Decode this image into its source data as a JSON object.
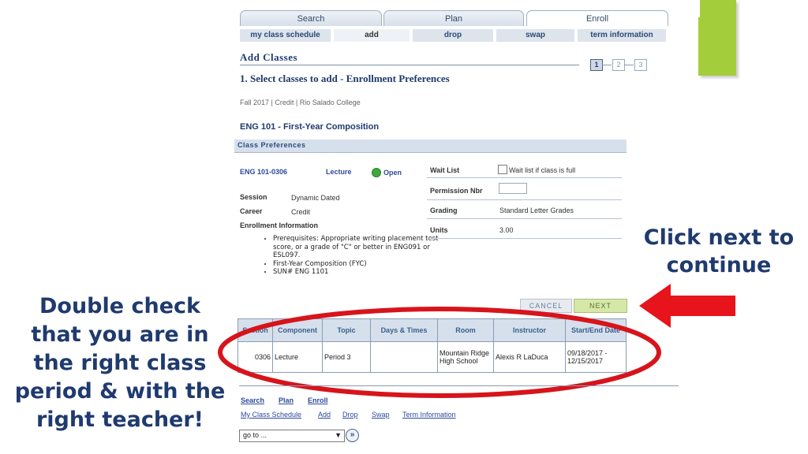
{
  "tabs": [
    {
      "label": "Search"
    },
    {
      "label": "Plan"
    },
    {
      "label": "Enroll"
    }
  ],
  "subtabs": [
    {
      "label": "my class schedule"
    },
    {
      "label": "add"
    },
    {
      "label": "drop"
    },
    {
      "label": "swap"
    },
    {
      "label": "term information"
    }
  ],
  "page": {
    "heading": "Add Classes",
    "step_title": "1.  Select classes to add - Enrollment Preferences",
    "steps": [
      "1",
      "2",
      "3"
    ],
    "term_line": "Fall 2017 | Credit | Rio Salado College",
    "course_title": "ENG  101 - First-Year Composition",
    "section_header": "Class Preferences"
  },
  "class_info": {
    "section_code": "ENG  101-0306",
    "component": "Lecture",
    "status": "Open",
    "session_label": "Session",
    "session_value": "Dynamic Dated",
    "career_label": "Career",
    "career_value": "Credit",
    "enrollment_info_label": "Enrollment Information",
    "bullets": [
      "Prerequisites: Appropriate writing placement test score, or a grade of \"C\" or better in ENG091 or ESL097.",
      "First-Year Composition (FYC)",
      "SUN# ENG 1101"
    ]
  },
  "prefs": {
    "wait_list_label": "Wait List",
    "wait_list_checkbox": "Wait list if class is full",
    "permission_label": "Permission Nbr",
    "permission_value": "",
    "grading_label": "Grading",
    "grading_value": "Standard Letter Grades",
    "units_label": "Units",
    "units_value": "3.00"
  },
  "buttons": {
    "cancel": "CANCEL",
    "next": "NEXT"
  },
  "table": {
    "headers": [
      "Section",
      "Component",
      "Topic",
      "Days & Times",
      "Room",
      "Instructor",
      "Start/End Date"
    ],
    "row": [
      "0306",
      "Lecture",
      "Period 3",
      "",
      "Mountain Ridge High School",
      "Alexis R LaDuca",
      "09/18/2017 - 12/15/2017"
    ]
  },
  "footer": {
    "primary_links": [
      "Search",
      "Plan",
      "Enroll"
    ],
    "secondary_links": [
      "My Class Schedule",
      "Add",
      "Drop",
      "Swap",
      "Term Information"
    ],
    "goto_value": "go to ..."
  },
  "annotations": {
    "right_note": "Click next to continue",
    "left_note": "Double check that you are in the right class period & with the right teacher!"
  },
  "colors": {
    "annotation_text": "#1f3a6e",
    "arrow": "#e8141b",
    "ellipse": "#d7141b",
    "slide_accent": "#a3cd3b",
    "open_status": "#3ea83e",
    "next_button": "#d6e8a8"
  }
}
